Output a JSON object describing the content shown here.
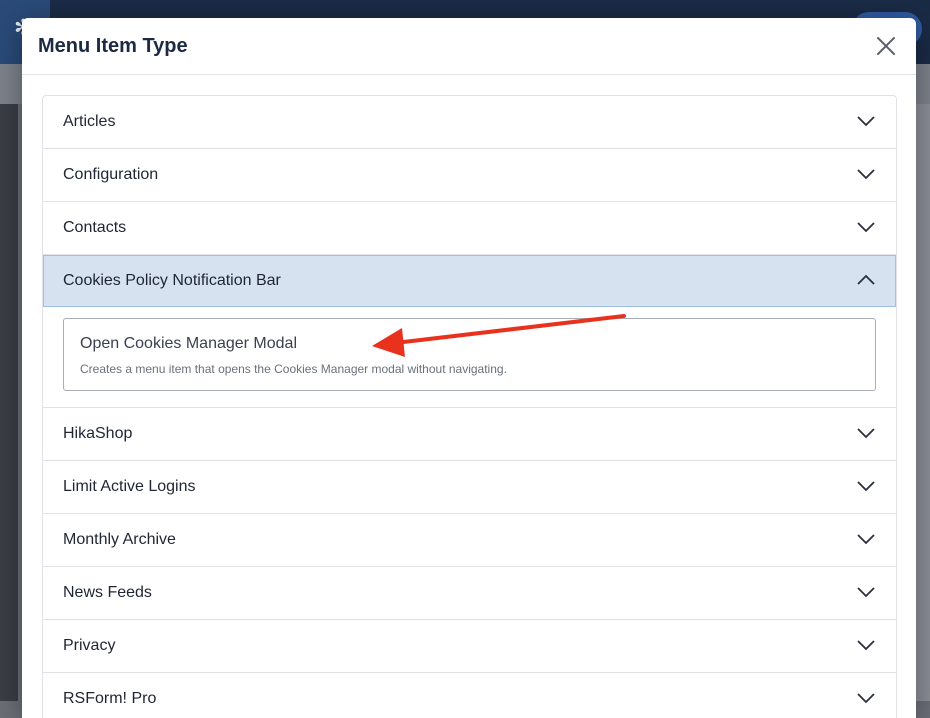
{
  "modal": {
    "title": "Menu Item Type",
    "close_icon": "close-icon"
  },
  "accordion": {
    "items": [
      {
        "label": "Articles",
        "expanded": false
      },
      {
        "label": "Configuration",
        "expanded": false
      },
      {
        "label": "Contacts",
        "expanded": false
      },
      {
        "label": "Cookies Policy Notification Bar",
        "expanded": true
      },
      {
        "label": "HikaShop",
        "expanded": false
      },
      {
        "label": "Limit Active Logins",
        "expanded": false
      },
      {
        "label": "Monthly Archive",
        "expanded": false
      },
      {
        "label": "News Feeds",
        "expanded": false
      },
      {
        "label": "Privacy",
        "expanded": false
      },
      {
        "label": "RSForm! Pro",
        "expanded": false
      }
    ],
    "open_option": {
      "title": "Open Cookies Manager Modal",
      "description": "Creates a menu item that opens the Cookies Manager modal without navigating."
    }
  },
  "colors": {
    "expanded_header_bg": "#d6e2f0",
    "annotation_arrow": "#e8321e",
    "title_text": "#1d2a44"
  }
}
